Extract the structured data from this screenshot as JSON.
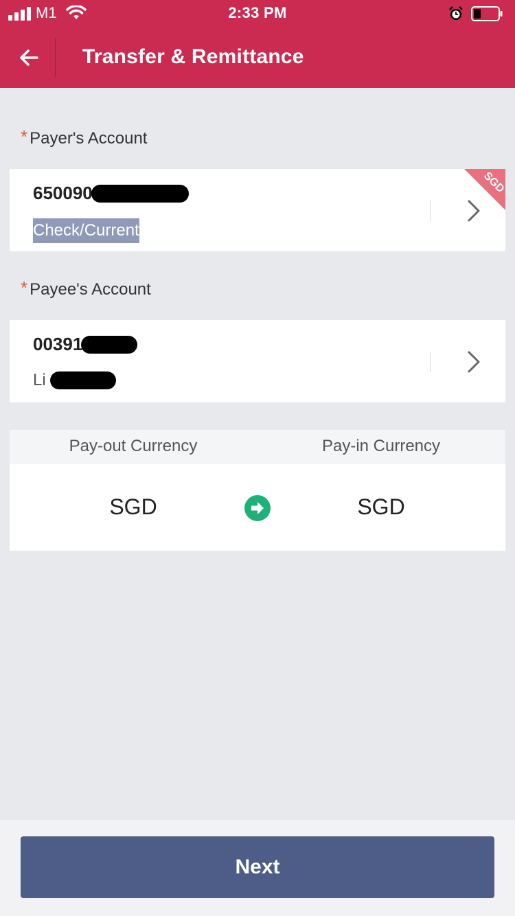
{
  "status_bar": {
    "carrier": "M1",
    "time": "2:33 PM"
  },
  "header": {
    "title": "Transfer & Remittance",
    "back_icon": "back-arrow-icon"
  },
  "payer": {
    "label": "Payer's Account",
    "required_mark": "*",
    "account_number_visible": "650090",
    "account_type": "Check/Current",
    "currency_tag": "SGD"
  },
  "payee": {
    "label": "Payee's Account",
    "required_mark": "*",
    "account_number_visible": "00391",
    "name_visible": "Li"
  },
  "currency": {
    "payout_label": "Pay-out Currency",
    "payin_label": "Pay-in Currency",
    "payout_value": "SGD",
    "payin_value": "SGD"
  },
  "footer": {
    "next_label": "Next"
  },
  "colors": {
    "header_bg": "#cb2a51",
    "button_bg": "#4e5d87",
    "accent_green": "#1fb07a",
    "required_red": "#e25b3a"
  }
}
